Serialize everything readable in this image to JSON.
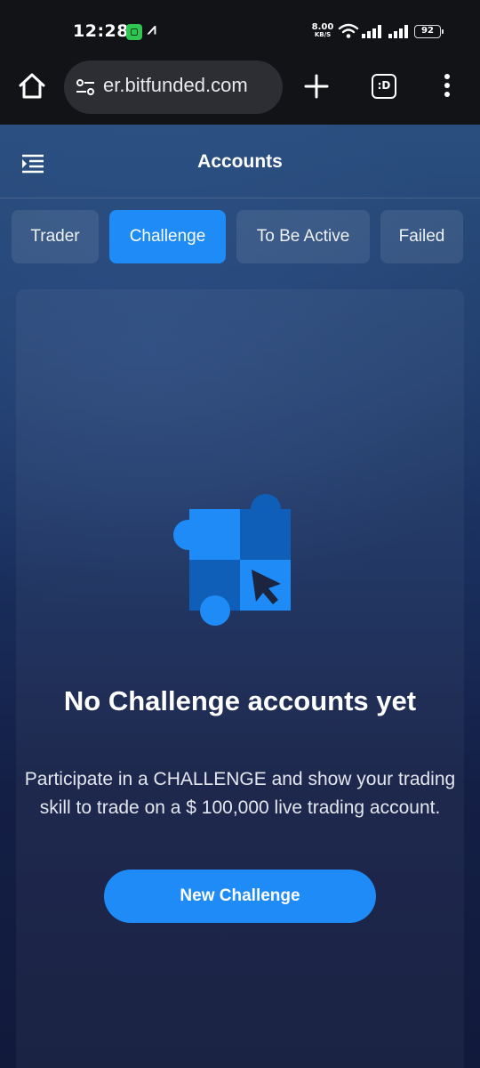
{
  "status_bar": {
    "time": "12:28",
    "net_speed_value": "8.00",
    "net_speed_unit": "KB/S",
    "battery": "92"
  },
  "browser": {
    "url": "er.bitfunded.com",
    "tabs_label": ":D"
  },
  "header": {
    "title": "Accounts"
  },
  "tabs": [
    {
      "label": "Trader",
      "active": false
    },
    {
      "label": "Challenge",
      "active": true
    },
    {
      "label": "To Be Active",
      "active": false
    },
    {
      "label": "Failed",
      "active": false
    }
  ],
  "empty_state": {
    "title": "No Challenge accounts yet",
    "description": "Participate in a CHALLENGE and show your trading skill to trade on a $ 100,000 live trading account.",
    "button_label": "New Challenge"
  },
  "colors": {
    "accent": "#1e8bf7",
    "status_bar_bg": "#111316"
  }
}
